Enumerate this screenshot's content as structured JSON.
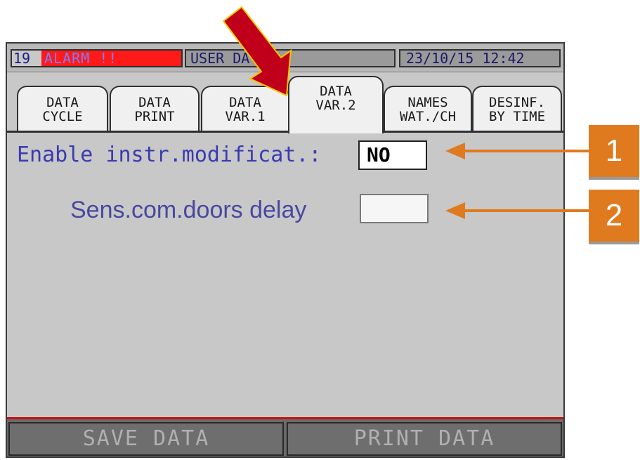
{
  "status_bar": {
    "screen_number": "19",
    "alarm_text": "ALARM !!",
    "section_title": "USER DA",
    "datetime": "23/10/15  12:42"
  },
  "tabs": [
    {
      "line1": "DATA",
      "line2": "CYCLE"
    },
    {
      "line1": "DATA",
      "line2": "PRINT"
    },
    {
      "line1": "DATA",
      "line2": "VAR.1"
    },
    {
      "line1": "DATA",
      "line2": "VAR.2",
      "active": true
    },
    {
      "line1": "NAMES",
      "line2": "WAT./CH"
    },
    {
      "line1": "DESINF.",
      "line2": "BY TIME"
    }
  ],
  "fields": {
    "enable_label": "Enable instr.modificat.:",
    "enable_value": "NO",
    "sens_label": "Sens.com.doors delay",
    "sens_value": ""
  },
  "buttons": {
    "save": "SAVE DATA",
    "print": "PRINT DATA"
  },
  "annotations": {
    "badge1": "1",
    "badge2": "2",
    "arrow_color": "#c0001a",
    "badge_color": "#e07a1f"
  }
}
